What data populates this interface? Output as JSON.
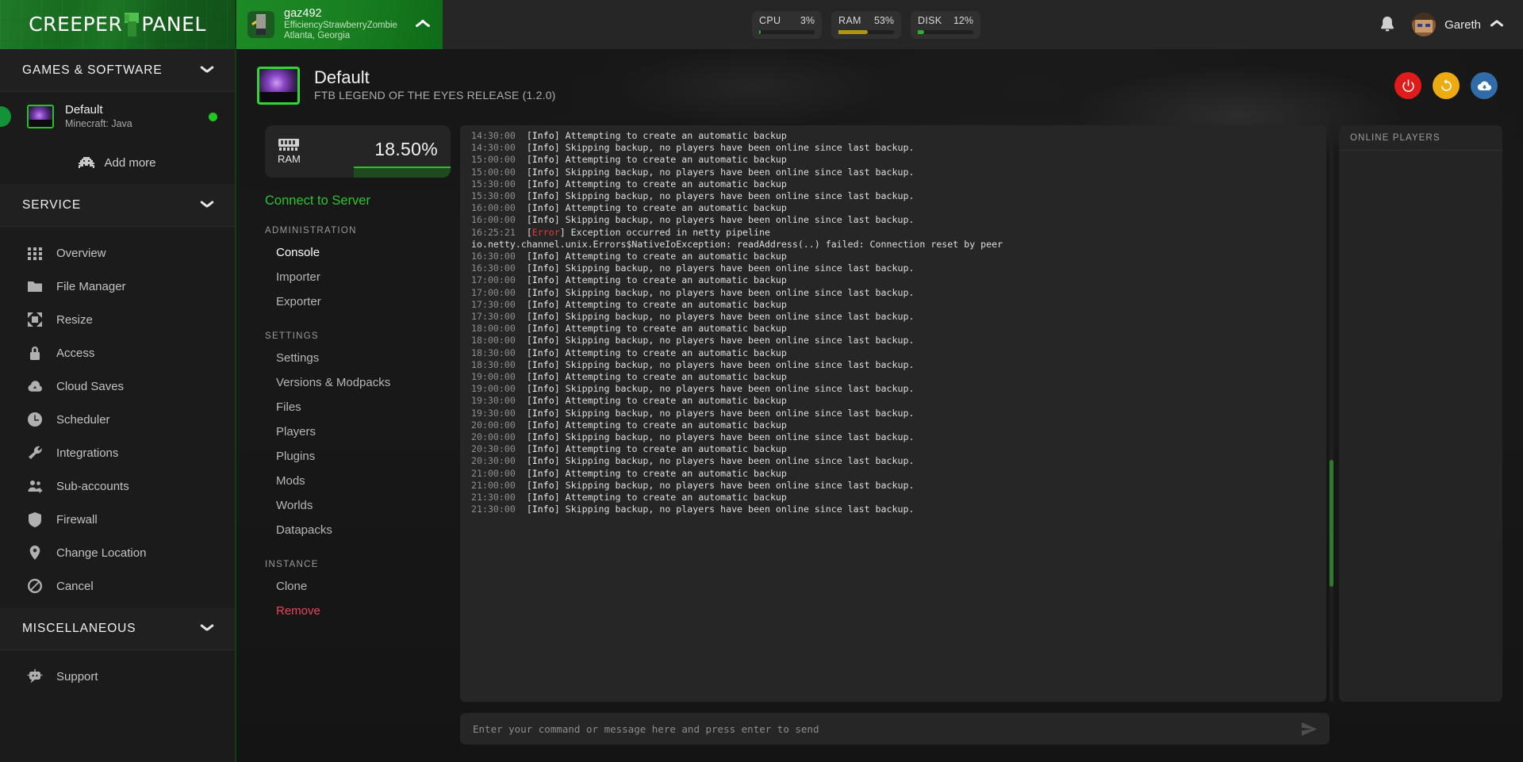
{
  "brand": {
    "name_left": "CREEPER",
    "name_right": "PANEL",
    "logo_icon": "creeper-logo-icon"
  },
  "sidebar": {
    "sections": [
      {
        "title": "GAMES & SOFTWARE",
        "chevron_icon": "chevron-down-icon"
      },
      {
        "title": "SERVICE",
        "chevron_icon": "chevron-down-icon"
      },
      {
        "title": "MISCELLANEOUS",
        "chevron_icon": "chevron-down-icon"
      }
    ],
    "game": {
      "name": "Default",
      "subtitle": "Minecraft: Java",
      "status": "online",
      "thumb_icon": "game-thumbnail-icon",
      "status_dot_color": "#22c522"
    },
    "add_more": {
      "label": "Add more",
      "icon": "space-invader-icon"
    },
    "service_items": [
      {
        "label": "Overview",
        "icon": "grid-icon"
      },
      {
        "label": "File Manager",
        "icon": "folder-icon"
      },
      {
        "label": "Resize",
        "icon": "resize-arrows-icon"
      },
      {
        "label": "Access",
        "icon": "lock-icon"
      },
      {
        "label": "Cloud Saves",
        "icon": "cloud-upload-icon"
      },
      {
        "label": "Scheduler",
        "icon": "clock-icon"
      },
      {
        "label": "Integrations",
        "icon": "wrench-icon"
      },
      {
        "label": "Sub-accounts",
        "icon": "users-icon"
      },
      {
        "label": "Firewall",
        "icon": "shield-icon"
      },
      {
        "label": "Change Location",
        "icon": "map-pin-icon"
      },
      {
        "label": "Cancel",
        "icon": "ban-circle-icon"
      }
    ],
    "misc_items": [
      {
        "label": "Support",
        "icon": "chat-bot-icon"
      }
    ]
  },
  "topbar": {
    "server_select": {
      "username": "gaz492",
      "instance": "EfficiencyStrawberryZombie",
      "location": "Atlanta, Georgia",
      "avatar_icon": "minecraft-skin-icon",
      "chevron_icon": "chevron-up-icon"
    },
    "stats": [
      {
        "label": "CPU",
        "value": "3%",
        "pct": 3,
        "color": "#2faf2f"
      },
      {
        "label": "RAM",
        "value": "53%",
        "pct": 53,
        "color": "#b0950f"
      },
      {
        "label": "DISK",
        "value": "12%",
        "pct": 12,
        "color": "#2faf2f"
      }
    ],
    "notifications_icon": "bell-icon",
    "user": {
      "name": "Gareth",
      "avatar_icon": "user-avatar-icon",
      "chevron_icon": "chevron-up-icon"
    }
  },
  "page": {
    "title": "Default",
    "subtitle": "FTB LEGEND OF THE EYES RELEASE (1.2.0)",
    "thumb_icon": "instance-thumbnail-icon",
    "actions": [
      {
        "name": "power",
        "icon": "power-icon",
        "color": "#e01b1b"
      },
      {
        "name": "restart",
        "icon": "restart-icon",
        "color": "#edab11"
      },
      {
        "name": "backup-download",
        "icon": "cloud-download-icon",
        "color": "#2f6ca8"
      }
    ]
  },
  "ram_card": {
    "icon": "memory-stick-icon",
    "label": "RAM",
    "value": "18.50%",
    "pct": 52,
    "bar_color": "#1e4a1e"
  },
  "connect_link": "Connect to Server",
  "side_menu": {
    "administration_label": "ADMINISTRATION",
    "administration": [
      {
        "label": "Console",
        "active": true
      },
      {
        "label": "Importer",
        "active": false
      },
      {
        "label": "Exporter",
        "active": false
      }
    ],
    "settings_label": "SETTINGS",
    "settings": [
      {
        "label": "Settings"
      },
      {
        "label": "Versions & Modpacks"
      },
      {
        "label": "Files"
      },
      {
        "label": "Players"
      },
      {
        "label": "Plugins"
      },
      {
        "label": "Mods"
      },
      {
        "label": "Worlds"
      },
      {
        "label": "Datapacks"
      }
    ],
    "instance_label": "INSTANCE",
    "instance": [
      {
        "label": "Clone",
        "danger": false
      },
      {
        "label": "Remove",
        "danger": true
      }
    ]
  },
  "console": {
    "lines": [
      {
        "ts": "14:30:00",
        "level": "Info",
        "msg": "Attempting to create an automatic backup"
      },
      {
        "ts": "14:30:00",
        "level": "Info",
        "msg": "Skipping backup, no players have been online since last backup."
      },
      {
        "ts": "15:00:00",
        "level": "Info",
        "msg": "Attempting to create an automatic backup"
      },
      {
        "ts": "15:00:00",
        "level": "Info",
        "msg": "Skipping backup, no players have been online since last backup."
      },
      {
        "ts": "15:30:00",
        "level": "Info",
        "msg": "Attempting to create an automatic backup"
      },
      {
        "ts": "15:30:00",
        "level": "Info",
        "msg": "Skipping backup, no players have been online since last backup."
      },
      {
        "ts": "16:00:00",
        "level": "Info",
        "msg": "Attempting to create an automatic backup"
      },
      {
        "ts": "16:00:00",
        "level": "Info",
        "msg": "Skipping backup, no players have been online since last backup."
      },
      {
        "ts": "16:25:21",
        "level": "Error",
        "msg": "Exception occurred in netty pipeline"
      },
      {
        "ts": "",
        "level": "",
        "msg": "io.netty.channel.unix.Errors$NativeIoException: readAddress(..) failed: Connection reset by peer"
      },
      {
        "ts": "16:30:00",
        "level": "Info",
        "msg": "Attempting to create an automatic backup"
      },
      {
        "ts": "16:30:00",
        "level": "Info",
        "msg": "Skipping backup, no players have been online since last backup."
      },
      {
        "ts": "17:00:00",
        "level": "Info",
        "msg": "Attempting to create an automatic backup"
      },
      {
        "ts": "17:00:00",
        "level": "Info",
        "msg": "Skipping backup, no players have been online since last backup."
      },
      {
        "ts": "17:30:00",
        "level": "Info",
        "msg": "Attempting to create an automatic backup"
      },
      {
        "ts": "17:30:00",
        "level": "Info",
        "msg": "Skipping backup, no players have been online since last backup."
      },
      {
        "ts": "18:00:00",
        "level": "Info",
        "msg": "Attempting to create an automatic backup"
      },
      {
        "ts": "18:00:00",
        "level": "Info",
        "msg": "Skipping backup, no players have been online since last backup."
      },
      {
        "ts": "18:30:00",
        "level": "Info",
        "msg": "Attempting to create an automatic backup"
      },
      {
        "ts": "18:30:00",
        "level": "Info",
        "msg": "Skipping backup, no players have been online since last backup."
      },
      {
        "ts": "19:00:00",
        "level": "Info",
        "msg": "Attempting to create an automatic backup"
      },
      {
        "ts": "19:00:00",
        "level": "Info",
        "msg": "Skipping backup, no players have been online since last backup."
      },
      {
        "ts": "19:30:00",
        "level": "Info",
        "msg": "Attempting to create an automatic backup"
      },
      {
        "ts": "19:30:00",
        "level": "Info",
        "msg": "Skipping backup, no players have been online since last backup."
      },
      {
        "ts": "20:00:00",
        "level": "Info",
        "msg": "Attempting to create an automatic backup"
      },
      {
        "ts": "20:00:00",
        "level": "Info",
        "msg": "Skipping backup, no players have been online since last backup."
      },
      {
        "ts": "20:30:00",
        "level": "Info",
        "msg": "Attempting to create an automatic backup"
      },
      {
        "ts": "20:30:00",
        "level": "Info",
        "msg": "Skipping backup, no players have been online since last backup."
      },
      {
        "ts": "21:00:00",
        "level": "Info",
        "msg": "Attempting to create an automatic backup"
      },
      {
        "ts": "21:00:00",
        "level": "Info",
        "msg": "Skipping backup, no players have been online since last backup."
      },
      {
        "ts": "21:30:00",
        "level": "Info",
        "msg": "Attempting to create an automatic backup"
      },
      {
        "ts": "21:30:00",
        "level": "Info",
        "msg": "Skipping backup, no players have been online since last backup."
      }
    ]
  },
  "players_panel": {
    "title": "ONLINE PLAYERS",
    "players": []
  },
  "command_bar": {
    "placeholder": "Enter your command or message here and press enter to send",
    "value": "",
    "send_icon": "send-plane-icon"
  }
}
